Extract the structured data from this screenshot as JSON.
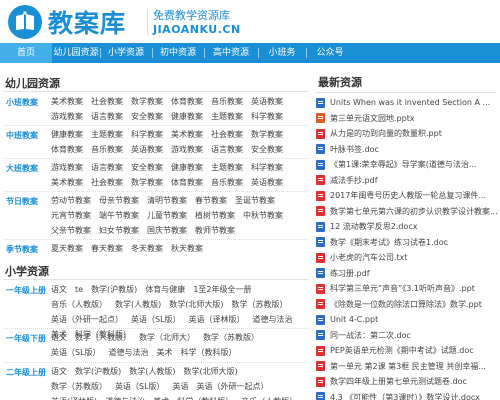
{
  "header": {
    "site_name": "教案库",
    "tagline": "免费教学资源库",
    "domain": "JIAOANKU.CN"
  },
  "nav": {
    "items": [
      {
        "label": "首页"
      },
      {
        "label": "幼儿园资源"
      },
      {
        "label": "小学资源"
      },
      {
        "label": "初中资源"
      },
      {
        "label": "高中资源"
      },
      {
        "label": "小班务"
      },
      {
        "label": "公众号"
      }
    ]
  },
  "kindergarten": {
    "title": "幼儿园资源",
    "rows": [
      {
        "label": "小班教案",
        "items": [
          "美术教案",
          "社会教案",
          "数学教案",
          "体育教案",
          "音乐教案",
          "英语教案",
          "游戏教案",
          "语言教案",
          "安全教案",
          "健康教案",
          "主题教案",
          "科学教案"
        ]
      },
      {
        "label": "中班教案",
        "items": [
          "健康教案",
          "主题教案",
          "科学教案",
          "美术教案",
          "社会教案",
          "数学教案",
          "体育教案",
          "音乐教案",
          "英语教案",
          "游戏教案",
          "语言教案",
          "安全教案"
        ]
      },
      {
        "label": "大班教案",
        "items": [
          "游戏教案",
          "语言教案",
          "安全教案",
          "健康教案",
          "主题教案",
          "科学教案",
          "美术教案",
          "社会教案",
          "数学教案",
          "体育教案",
          "音乐教案",
          "英语教案"
        ]
      },
      {
        "label": "节日教案",
        "items": [
          "劳动节教案",
          "母亲节教案",
          "清明节教案",
          "春节教案",
          "圣诞节教案",
          "元宵节教案",
          "端午节教案",
          "儿童节教案",
          "植树节教案",
          "中秋节教案",
          "父亲节教案",
          "妇女节教案",
          "国庆节教案",
          "教师节教案"
        ]
      },
      {
        "label": "季节教案",
        "items": [
          "夏天教案",
          "春天教案",
          "冬天教案",
          "秋天教案"
        ]
      }
    ]
  },
  "primary": {
    "title": "小学资源",
    "rows": [
      {
        "label": "一年级上册",
        "items": [
          "语文",
          "te",
          "数学(沪教版)",
          "体育与健康",
          "1至2年级全一册",
          "音乐（人教版）",
          "数学(人教版)",
          "数学(北师大版)",
          "数学（苏教版）",
          "英语（外研一起点）",
          "英语（SL版）",
          "英语（译林版）",
          "道德与法治",
          "美术",
          "科学（教科版）"
        ]
      },
      {
        "label": "一年级下册",
        "items": [
          "语文",
          "数学（人教版）",
          "数学（北师大）",
          "数学（苏教版）",
          "英语（SL版）",
          "道德与法治",
          "美术",
          "科学（教科版）"
        ]
      },
      {
        "label": "二年级上册",
        "items": [
          "语文",
          "数学(沪教版)",
          "数学(人教版)",
          "数学(北师大版)",
          "数学（苏教版）",
          "英语（SL版）",
          "英语",
          "英语（外研一起点）",
          "英语(译林版)",
          "道德与法治",
          "美术",
          "科学（教科版）",
          "音乐（人教版）"
        ]
      }
    ]
  },
  "latest": {
    "title": "最新资源",
    "items": [
      {
        "type": "word",
        "text": "Units When was it invented Section A ..."
      },
      {
        "type": "ppt",
        "text": "第三单元语文园地.pptx"
      },
      {
        "type": "pdf",
        "text": "从力是的功到向量的数量积.ppt"
      },
      {
        "type": "word",
        "text": "叶脉书签.doc"
      },
      {
        "type": "word",
        "text": "《第1课:荣幸辱起》导学案(道德与法治..."
      },
      {
        "type": "pdf",
        "text": "减法手抄.pdf"
      },
      {
        "type": "pdf",
        "text": "2017年闽粤号历史人教版一轮总复习课件..."
      },
      {
        "type": "pdf",
        "text": "数学第七单元第六课的初步认识教学设计教案..."
      },
      {
        "type": "word",
        "text": "12 流动教学反思2.docx"
      },
      {
        "type": "word",
        "text": "数学《期末考试》练习试卷1.doc"
      },
      {
        "type": "pdf",
        "text": "小老虎的汽车公司.txt"
      },
      {
        "type": "word",
        "text": "练习册.pdf"
      },
      {
        "type": "pdf",
        "text": "科学第三单元“声音”《3.1听听声音》.ppt"
      },
      {
        "type": "pdf",
        "text": "《除数是一位数的除法口算除法》数学.ppt"
      },
      {
        "type": "word",
        "text": "Unit 4-C.ppt"
      },
      {
        "type": "word",
        "text": "同一战法：第二次.doc"
      },
      {
        "type": "pdf",
        "text": "PEP英语单元检测《期中考试》试题.doc"
      },
      {
        "type": "pdf",
        "text": "第一单元 第2课 第3框 民主管理 共创幸福..."
      },
      {
        "type": "pdf",
        "text": "数学四年级上册第七单元测试题卷.doc"
      },
      {
        "type": "word",
        "text": "4.3 《可能性（第3课时）》数学设计.docx"
      }
    ]
  }
}
